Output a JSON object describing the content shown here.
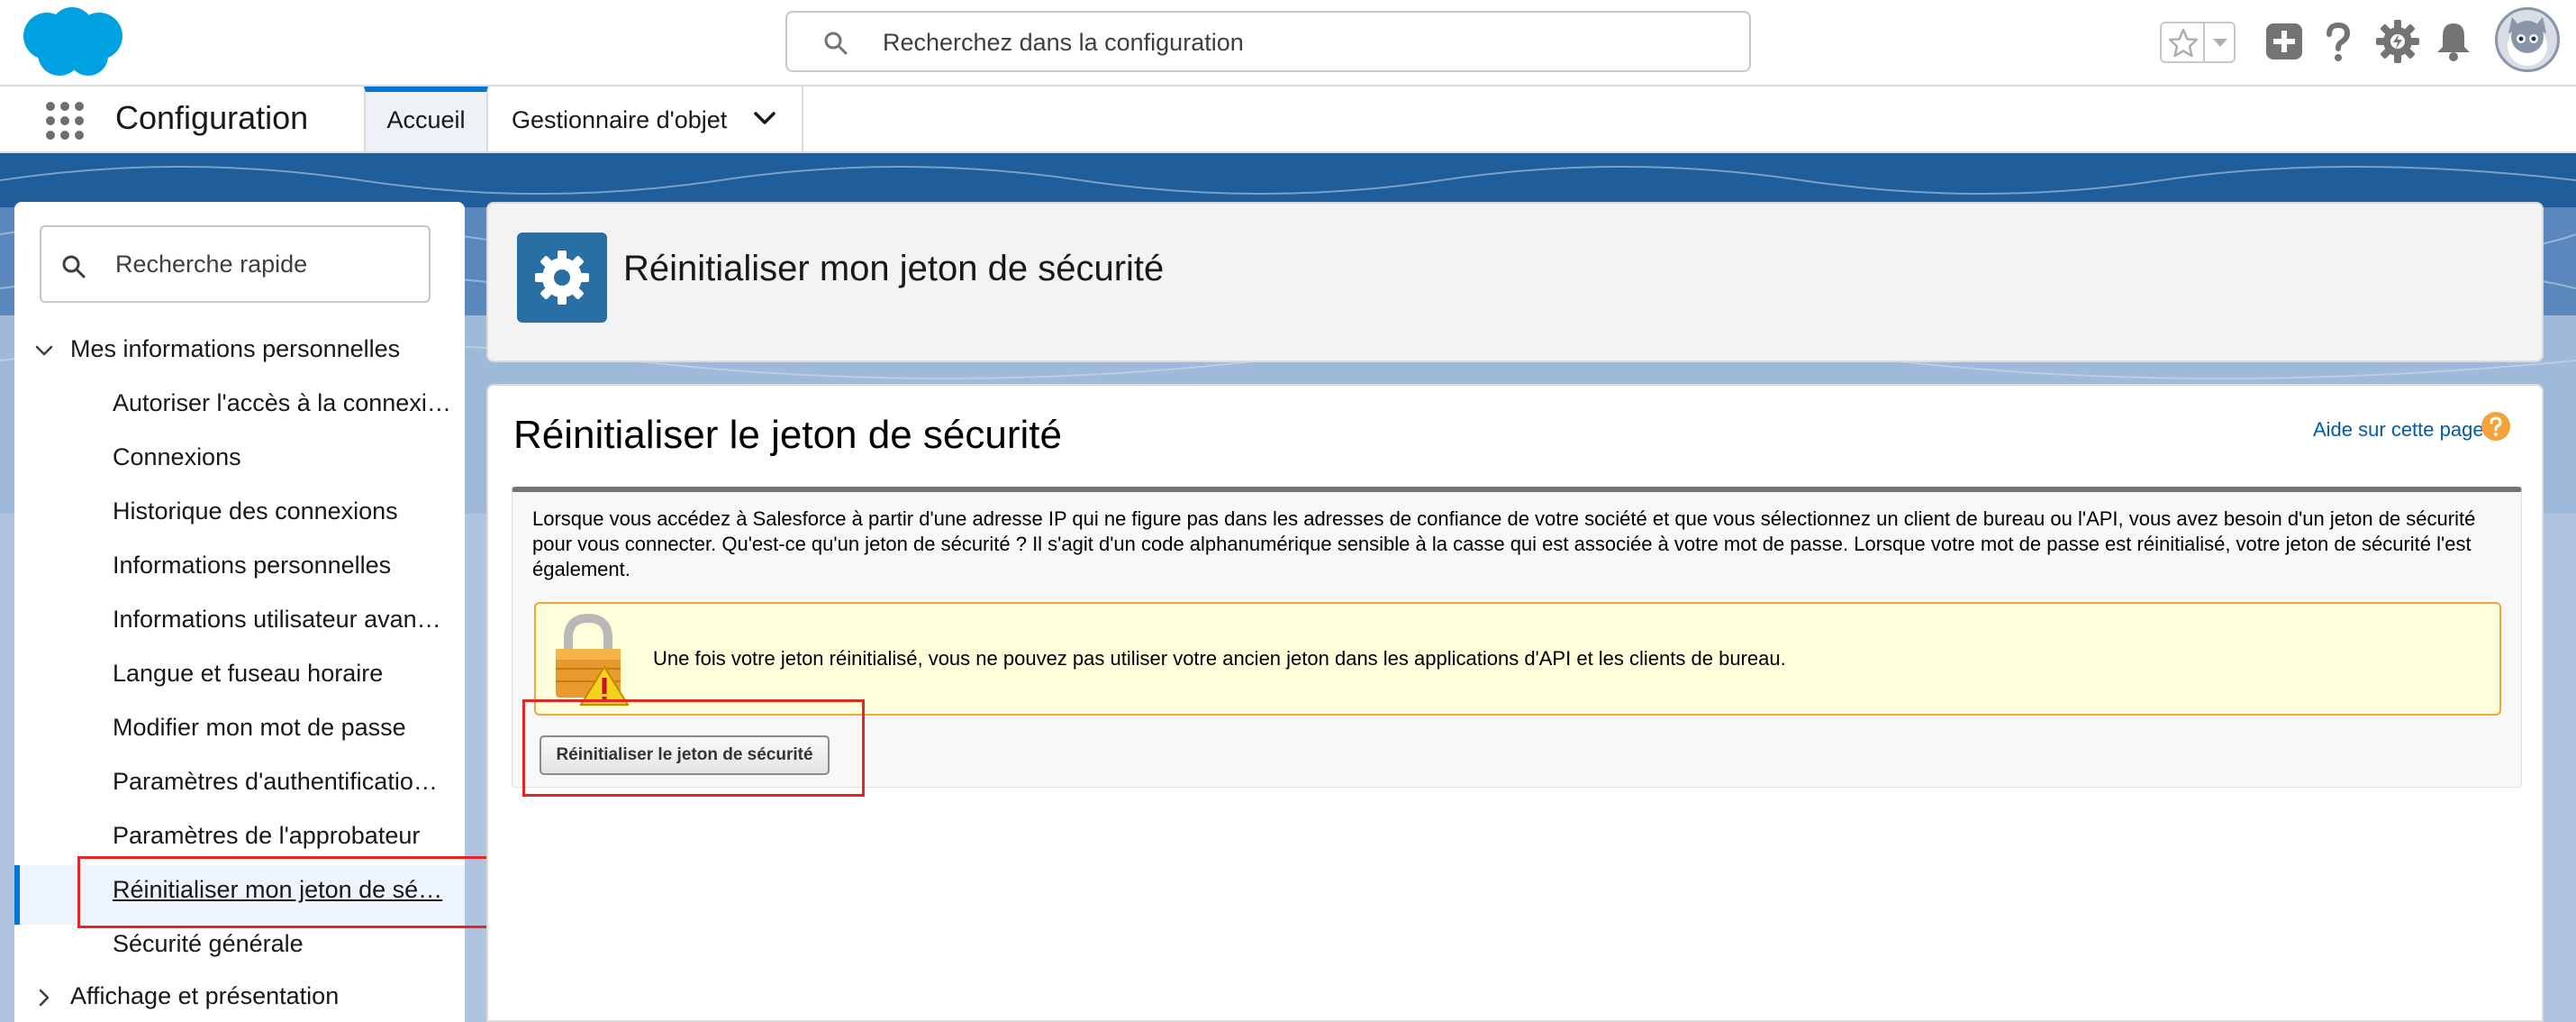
{
  "header": {
    "search_placeholder": "Recherchez dans la configuration",
    "icons": [
      "salesforce-logo",
      "star-icon",
      "chevron-down-icon",
      "add-icon",
      "help-icon",
      "setup-gear-icon",
      "bell-icon",
      "avatar"
    ]
  },
  "context_bar": {
    "app_name": "Configuration",
    "tabs": [
      {
        "label": "Accueil",
        "active": true
      },
      {
        "label": "Gestionnaire d'objet",
        "active": false
      }
    ]
  },
  "sidebar": {
    "quick_find_placeholder": "Recherche rapide",
    "groups": [
      {
        "label": "Mes informations personnelles",
        "expanded": true,
        "items": [
          {
            "label": "Autoriser l'accès à la connexi…"
          },
          {
            "label": "Connexions"
          },
          {
            "label": "Historique des connexions"
          },
          {
            "label": "Informations personnelles"
          },
          {
            "label": "Informations utilisateur avan…"
          },
          {
            "label": "Langue et fuseau horaire"
          },
          {
            "label": "Modifier mon mot de passe"
          },
          {
            "label": "Paramètres d'authentificatio…"
          },
          {
            "label": "Paramètres de l'approbateur"
          },
          {
            "label": "Réinitialiser mon jeton de sé…",
            "active": true
          },
          {
            "label": "Sécurité générale"
          }
        ]
      },
      {
        "label": "Affichage et présentation",
        "expanded": false
      }
    ]
  },
  "page_header": {
    "title": "Réinitialiser mon jeton de sécurité"
  },
  "main": {
    "title": "Réinitialiser le jeton de sécurité",
    "help_link": "Aide sur cette page",
    "description": "Lorsque vous accédez à Salesforce à partir d'une adresse IP qui ne figure pas dans les adresses de confiance de votre société et que vous sélectionnez un client de bureau ou l'API, vous avez besoin d'un jeton de sécurité pour vous connecter. Qu'est-ce qu'un jeton de sécurité ? Il s'agit d'un code alphanumérique sensible à la casse qui est associée à votre mot de passe. Lorsque votre mot de passe est réinitialisé, votre jeton de sécurité l'est également.",
    "warning": "Une fois votre jeton réinitialisé, vous ne pouvez pas utiliser votre ancien jeton dans les applications d'API et les clients de bureau.",
    "reset_button": "Réinitialiser le jeton de sécurité"
  },
  "colors": {
    "brand_blue": "#0176d3",
    "highlight_red": "#e32727",
    "warning_bg": "#ffffdc",
    "warning_border": "#f3a339"
  }
}
